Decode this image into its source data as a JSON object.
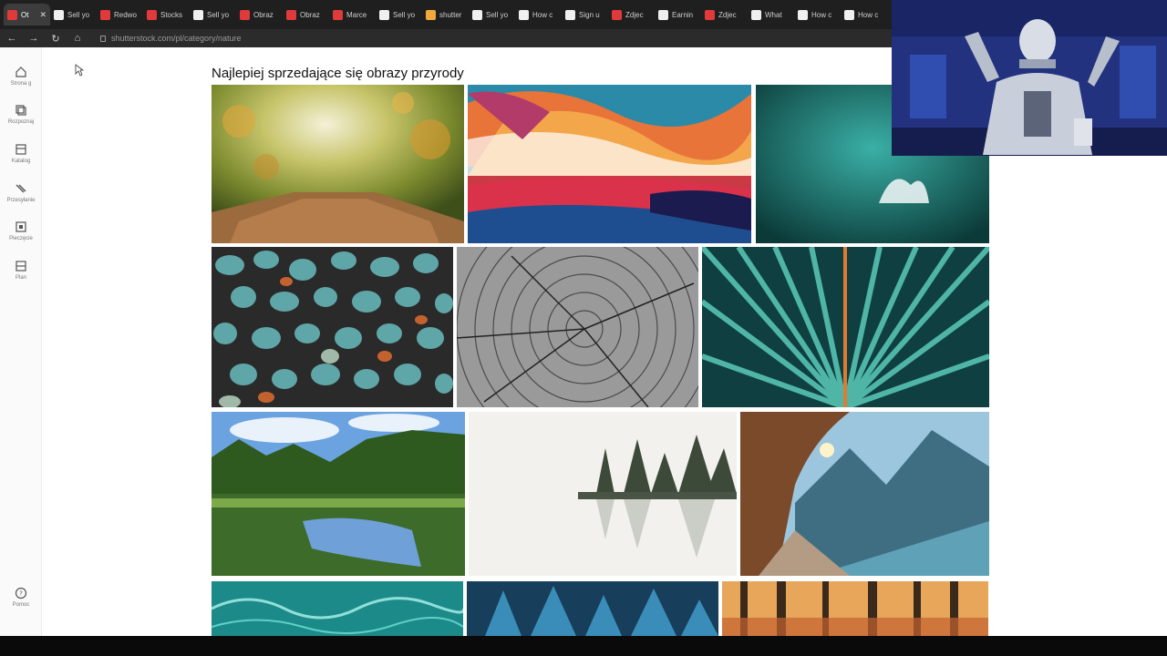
{
  "browser": {
    "tabs": [
      {
        "label": "Ot",
        "color": "#e03a3a",
        "active": true
      },
      {
        "label": "Sell yo",
        "color": "#f0f0f0"
      },
      {
        "label": "Redwo",
        "color": "#e03a3a"
      },
      {
        "label": "Stocks",
        "color": "#e03a3a"
      },
      {
        "label": "Sell yo",
        "color": "#f0f0f0"
      },
      {
        "label": "Obraz",
        "color": "#e03a3a"
      },
      {
        "label": "Obraz",
        "color": "#e03a3a"
      },
      {
        "label": "Marce",
        "color": "#e03a3a"
      },
      {
        "label": "Sell yo",
        "color": "#f0f0f0"
      },
      {
        "label": "shutter",
        "color": "#f2a93b"
      },
      {
        "label": "Sell yo",
        "color": "#f0f0f0"
      },
      {
        "label": "How c",
        "color": "#f0f0f0"
      },
      {
        "label": "Sign u",
        "color": "#f0f0f0"
      },
      {
        "label": "Zdjec",
        "color": "#e03a3a"
      },
      {
        "label": "Earnin",
        "color": "#f0f0f0"
      },
      {
        "label": "Zdjec",
        "color": "#e03a3a"
      },
      {
        "label": "What",
        "color": "#f0f0f0"
      },
      {
        "label": "How c",
        "color": "#f0f0f0"
      },
      {
        "label": "How c",
        "color": "#f0f0f0"
      }
    ],
    "close_glyph": "✕",
    "url": "shutterstock.com/pl/category/nature"
  },
  "sidebar": {
    "items": [
      {
        "label": "Strona g",
        "icon": "home-icon"
      },
      {
        "label": "Rozpoznaj",
        "icon": "layers-icon"
      },
      {
        "label": "Katalog",
        "icon": "catalog-icon"
      },
      {
        "label": "Przesyłanie",
        "icon": "upload-icon"
      },
      {
        "label": "Pieczęcie",
        "icon": "stamp-icon"
      },
      {
        "label": "Plan",
        "icon": "plan-icon"
      }
    ],
    "help_label": "Pomoc"
  },
  "main": {
    "heading": "Najlepiej sprzedające się obrazy przyrody"
  }
}
